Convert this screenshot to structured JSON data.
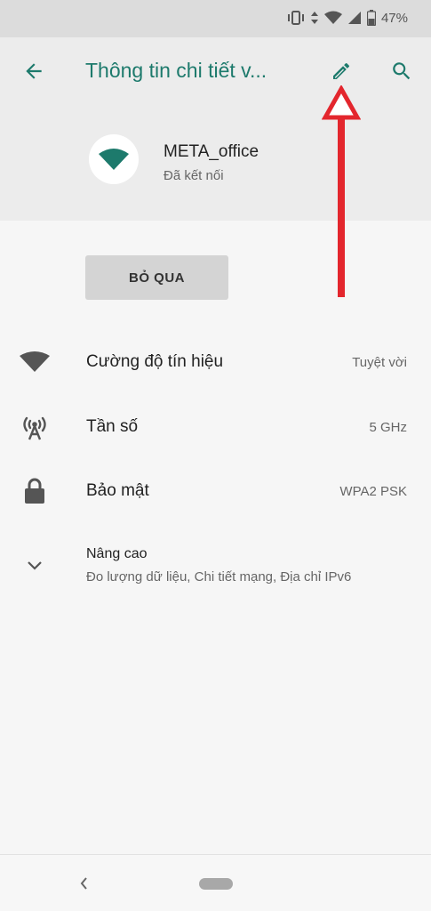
{
  "status_bar": {
    "battery_text": "47%",
    "icons": [
      "vibrate-icon",
      "data-arrows-icon",
      "wifi-signal-icon",
      "cell-signal-icon",
      "battery-icon"
    ]
  },
  "toolbar": {
    "title": "Thông tin chi tiết v...",
    "icons": {
      "back": "back-arrow-icon",
      "edit": "pencil-icon",
      "search": "search-icon"
    }
  },
  "network": {
    "name": "META_office",
    "status": "Đã kết nối",
    "icon": "wifi-icon"
  },
  "forget_button": {
    "label": "BỎ QUA"
  },
  "details": [
    {
      "label": "Cường độ tín hiệu",
      "value": "Tuyệt vời",
      "icon": "wifi-signal-icon"
    },
    {
      "label": "Tần số",
      "value": "5 GHz",
      "icon": "antenna-icon"
    },
    {
      "label": "Bảo mật",
      "value": "WPA2 PSK",
      "icon": "lock-icon"
    }
  ],
  "advanced": {
    "title": "Nâng cao",
    "summary": "Đo lượng dữ liệu, Chi tiết mạng, Địa chỉ IPv6",
    "icon": "chevron-down-icon"
  },
  "colors": {
    "accent": "#1d7a6c",
    "annotation_arrow": "#e3262d",
    "status_bar": "#dcdcdc",
    "header_bg": "#ececec",
    "page_bg": "#f6f6f6"
  }
}
